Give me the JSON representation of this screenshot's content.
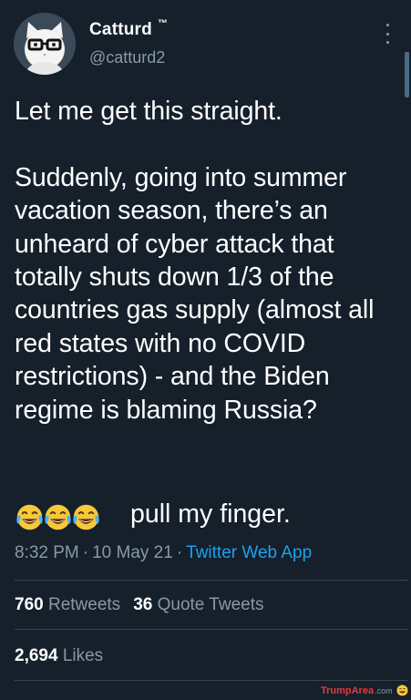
{
  "tweet": {
    "display_name": "Catturd",
    "trademark": "™",
    "handle": "@catturd2",
    "text": "Let me get this straight.\n\nSuddenly, going into summer vacation season, there’s an unheard of cyber attack that totally shuts down 1/3 of the countries gas supply (almost all red states with no COVID restrictions) - and the Biden regime is blaming Russia?",
    "emojis": [
      "face-with-tears-of-joy",
      "face-with-tears-of-joy",
      "face-with-tears-of-joy"
    ],
    "emoji_text": "pull my finger.",
    "time": "8:32 PM",
    "date": "10 May 21",
    "separator": "·",
    "source": "Twitter Web App"
  },
  "stats": {
    "retweets_count": "760",
    "retweets_label": "Retweets",
    "quotes_count": "36",
    "quotes_label": "Quote Tweets",
    "likes_count": "2,694",
    "likes_label": "Likes"
  },
  "watermark": {
    "brand": "TrumpArea",
    "suffix": ".com"
  },
  "colors": {
    "background": "#15202b",
    "text": "#ffffff",
    "secondary": "#8899a6",
    "link": "#1da1f2",
    "divider": "#38444d"
  }
}
